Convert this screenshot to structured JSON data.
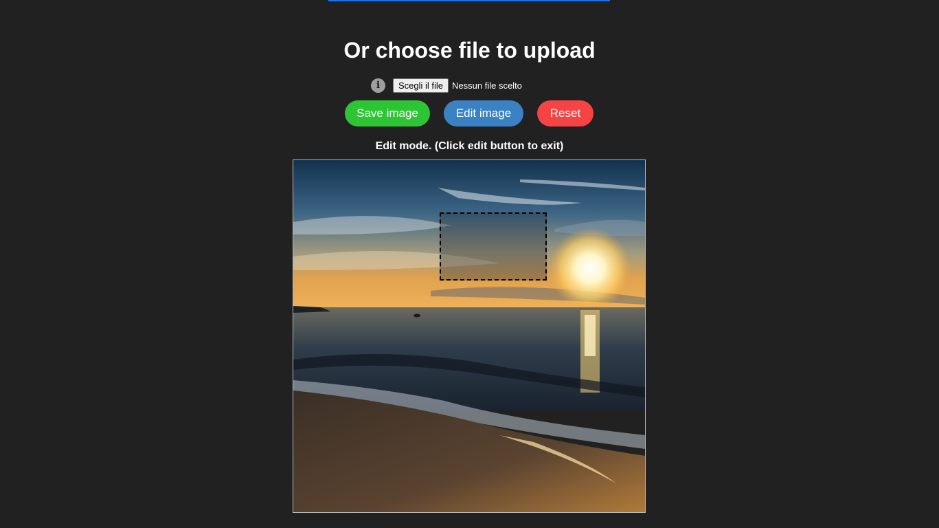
{
  "header": {
    "title": "Or choose file to upload"
  },
  "file_input": {
    "button_label": "Scegli il file",
    "status": "Nessun file scelto",
    "info_icon": "info-icon"
  },
  "actions": {
    "save_label": "Save image",
    "edit_label": "Edit image",
    "reset_label": "Reset"
  },
  "colors": {
    "save": "#2ec535",
    "edit": "#3b82c4",
    "reset": "#f64444",
    "accent_bar": "#1a73e8"
  },
  "editor": {
    "mode_text": "Edit mode. (Click edit button to exit)"
  }
}
